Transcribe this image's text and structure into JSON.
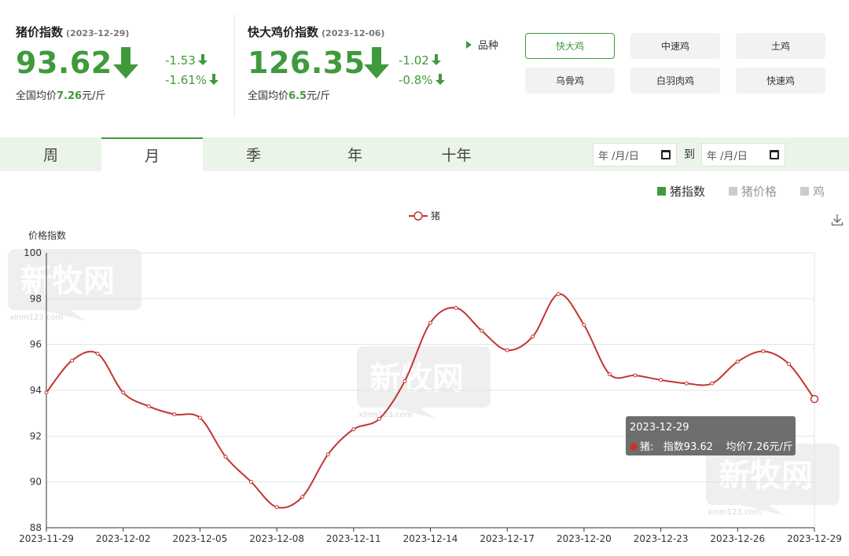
{
  "pig_index": {
    "title": "猪价指数",
    "date": "(2023-12-29)",
    "value": "93.62",
    "change_abs": "-1.53",
    "change_pct": "-1.61%",
    "avg_prefix": "全国均价",
    "avg_value": "7.26",
    "avg_unit": "元/斤"
  },
  "chicken_index": {
    "title": "快大鸡价指数",
    "date": "(2023-12-06)",
    "value": "126.35",
    "change_abs": "-1.02",
    "change_pct": "-0.8%",
    "avg_prefix": "全国均价",
    "avg_value": "6.5",
    "avg_unit": "元/斤"
  },
  "variety": {
    "label": "品种",
    "options": [
      "快大鸡",
      "中速鸡",
      "土鸡",
      "乌骨鸡",
      "白羽肉鸡",
      "快速鸡"
    ],
    "selected": "快大鸡"
  },
  "tabs": [
    "周",
    "月",
    "季",
    "年",
    "十年"
  ],
  "active_tab": "月",
  "date_range": {
    "start_placeholder": "年 /月/日",
    "to_label": "到",
    "end_placeholder": "年 /月/日"
  },
  "toggles": [
    {
      "label": "猪指数",
      "color": "#3f9a3b"
    },
    {
      "label": "猪价格",
      "color": "#cccccc"
    },
    {
      "label": "鸡",
      "color": "#cccccc"
    }
  ],
  "colors": {
    "accent": "#3f9a3b",
    "series": "#c23531",
    "grid": "#e3e3e3"
  },
  "watermark": "新牧网",
  "watermark_sub": "xinm123.com",
  "tooltip": {
    "date": "2023-12-29",
    "series": "猪:",
    "index_text": "指数93.62",
    "price_text": "均价7.26元/斤"
  },
  "chart_data": {
    "type": "line",
    "ylabel": "价格指数",
    "ylim": [
      88,
      100
    ],
    "yticks": [
      88,
      90,
      92,
      94,
      96,
      98,
      100
    ],
    "x": [
      "2023-11-29",
      "2023-11-30",
      "2023-12-01",
      "2023-12-02",
      "2023-12-03",
      "2023-12-04",
      "2023-12-05",
      "2023-12-06",
      "2023-12-07",
      "2023-12-08",
      "2023-12-09",
      "2023-12-10",
      "2023-12-11",
      "2023-12-12",
      "2023-12-13",
      "2023-12-14",
      "2023-12-15",
      "2023-12-16",
      "2023-12-17",
      "2023-12-18",
      "2023-12-19",
      "2023-12-20",
      "2023-12-21",
      "2023-12-22",
      "2023-12-23",
      "2023-12-24",
      "2023-12-25",
      "2023-12-26",
      "2023-12-27",
      "2023-12-28",
      "2023-12-29"
    ],
    "xtick_labels": [
      "2023-11-29",
      "2023-12-02",
      "2023-12-05",
      "2023-12-08",
      "2023-12-11",
      "2023-12-14",
      "2023-12-17",
      "2023-12-20",
      "2023-12-23",
      "2023-12-26",
      "2023-12-29"
    ],
    "series": [
      {
        "name": "猪",
        "values": [
          93.9,
          95.3,
          95.6,
          93.9,
          93.3,
          92.95,
          92.8,
          91.1,
          90.0,
          88.9,
          89.35,
          91.2,
          92.3,
          92.75,
          94.4,
          96.95,
          97.6,
          96.6,
          95.75,
          96.35,
          98.2,
          96.85,
          94.7,
          94.65,
          94.45,
          94.3,
          94.3,
          95.25,
          95.7,
          95.15,
          93.62
        ]
      }
    ],
    "grid": true,
    "legend": "top-center"
  }
}
